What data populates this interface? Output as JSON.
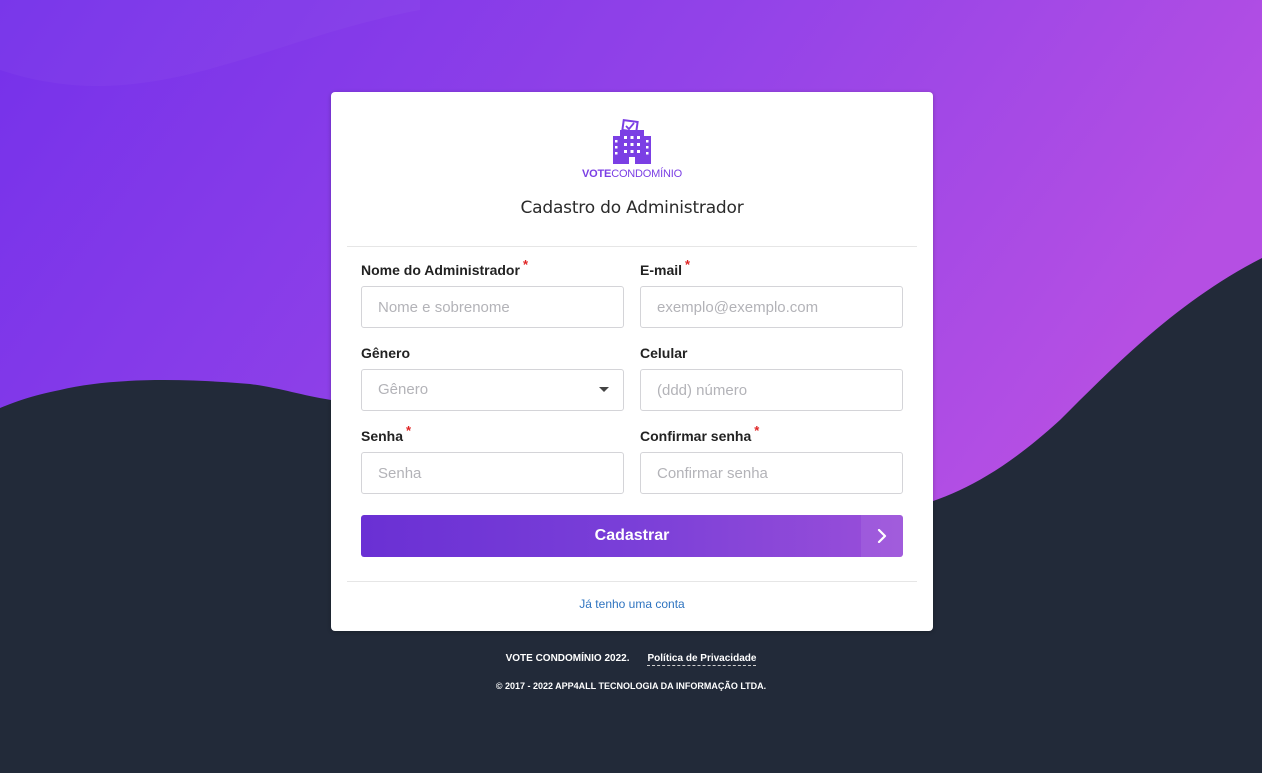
{
  "brand": {
    "name_bold": "VOTE",
    "name_regular": "CONDOMÍNIO",
    "accent_color": "#7b3fe4"
  },
  "form": {
    "title": "Cadastro do Administrador",
    "fields": {
      "name": {
        "label": "Nome do Administrador",
        "required": "*",
        "placeholder": "Nome e sobrenome",
        "value": ""
      },
      "email": {
        "label": "E-mail",
        "required": "*",
        "placeholder": "exemplo@exemplo.com",
        "value": ""
      },
      "gender": {
        "label": "Gênero",
        "selected": "Gênero"
      },
      "phone": {
        "label": "Celular",
        "placeholder": "(ddd) número",
        "value": ""
      },
      "password": {
        "label": "Senha",
        "required": "*",
        "placeholder": "Senha",
        "value": ""
      },
      "confirm_password": {
        "label": "Confirmar senha",
        "required": "*",
        "placeholder": "Confirmar senha",
        "value": ""
      }
    },
    "submit_label": "Cadastrar",
    "login_link": "Já tenho uma conta"
  },
  "footer": {
    "copyright_short": "VOTE CONDOMÍNIO 2022.",
    "privacy_link": "Política de Privacidade",
    "copyright_full": "© 2017 - 2022 APP4ALL TECNOLOGIA DA INFORMAÇÃO LTDA."
  },
  "icons": {
    "logo": "building-ballot-icon",
    "submit_arrow": "chevron-right-icon",
    "select_caret": "caret-down-icon"
  },
  "colors": {
    "background_top": "#7a34ea",
    "background_bottom": "#222a39",
    "required": "#e02424",
    "link": "#2f74c0"
  }
}
